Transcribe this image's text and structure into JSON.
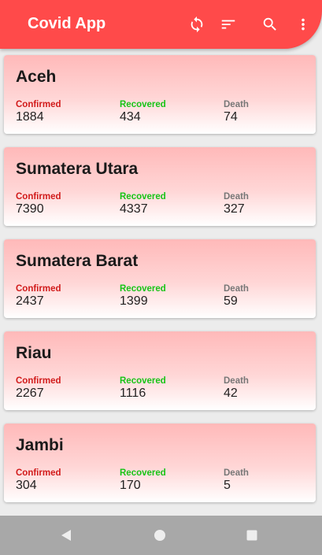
{
  "app": {
    "title": "Covid App",
    "accent": "#ff4a4a"
  },
  "toolbar": {
    "actions": [
      {
        "icon": "refresh-icon"
      },
      {
        "icon": "sort-icon"
      },
      {
        "icon": "search-icon"
      },
      {
        "icon": "more-vert-icon"
      }
    ]
  },
  "labels": {
    "confirmed": "Confirmed",
    "recovered": "Recovered",
    "death": "Death"
  },
  "colors": {
    "confirmed": "#d11a1a",
    "recovered": "#17c417",
    "death": "#777777"
  },
  "provinces": [
    {
      "name": "Aceh",
      "confirmed": "1884",
      "recovered": "434",
      "death": "74"
    },
    {
      "name": "Sumatera Utara",
      "confirmed": "7390",
      "recovered": "4337",
      "death": "327"
    },
    {
      "name": "Sumatera Barat",
      "confirmed": "2437",
      "recovered": "1399",
      "death": "59"
    },
    {
      "name": "Riau",
      "confirmed": "2267",
      "recovered": "1116",
      "death": "42"
    },
    {
      "name": "Jambi",
      "confirmed": "304",
      "recovered": "170",
      "death": "5"
    }
  ],
  "navbar": {
    "buttons": [
      {
        "icon": "back-icon"
      },
      {
        "icon": "home-icon"
      },
      {
        "icon": "recents-icon"
      }
    ]
  }
}
